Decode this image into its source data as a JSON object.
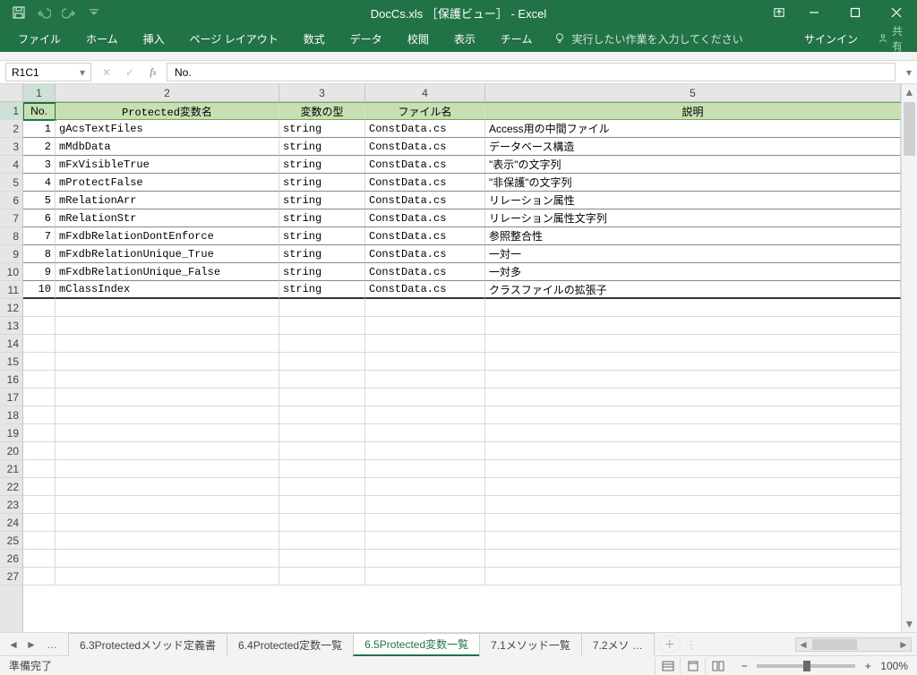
{
  "title": "DocCs.xls ［保護ビュー］ - Excel",
  "qat": {
    "save": "save",
    "undo": "undo",
    "redo": "redo"
  },
  "ribbon": {
    "tabs": [
      "ファイル",
      "ホーム",
      "挿入",
      "ページ レイアウト",
      "数式",
      "データ",
      "校閲",
      "表示",
      "チーム"
    ],
    "tellme": "実行したい作業を入力してください",
    "signin": "サインイン",
    "share": "共有"
  },
  "namebox": "R1C1",
  "formula": "No.",
  "columns": [
    "1",
    "2",
    "3",
    "4",
    "5"
  ],
  "headers": {
    "no": "No.",
    "name": "Protected変数名",
    "type": "変数の型",
    "file": "ファイル名",
    "desc": "説明"
  },
  "rows": [
    {
      "no": "1",
      "name": "gAcsTextFiles",
      "type": "string",
      "file": "ConstData.cs",
      "desc": "Access用の中間ファイル"
    },
    {
      "no": "2",
      "name": "mMdbData",
      "type": "string",
      "file": "ConstData.cs",
      "desc": "データベース構造"
    },
    {
      "no": "3",
      "name": "mFxVisibleTrue",
      "type": "string",
      "file": "ConstData.cs",
      "desc": "\"表示\"の文字列"
    },
    {
      "no": "4",
      "name": "mProtectFalse",
      "type": "string",
      "file": "ConstData.cs",
      "desc": "\"非保護\"の文字列"
    },
    {
      "no": "5",
      "name": "mRelationArr",
      "type": "string",
      "file": "ConstData.cs",
      "desc": "リレーション属性"
    },
    {
      "no": "6",
      "name": "mRelationStr",
      "type": "string",
      "file": "ConstData.cs",
      "desc": "リレーション属性文字列"
    },
    {
      "no": "7",
      "name": "mFxdbRelationDontEnforce",
      "type": "string",
      "file": "ConstData.cs",
      "desc": "参照整合性"
    },
    {
      "no": "8",
      "name": "mFxdbRelationUnique_True",
      "type": "string",
      "file": "ConstData.cs",
      "desc": "一対一"
    },
    {
      "no": "9",
      "name": "mFxdbRelationUnique_False",
      "type": "string",
      "file": "ConstData.cs",
      "desc": "一対多"
    },
    {
      "no": "10",
      "name": "mClassIndex",
      "type": "string",
      "file": "ConstData.cs",
      "desc": "クラスファイルの拡張子"
    }
  ],
  "row_count_visible": 27,
  "sheet_tabs": {
    "ellipsis": "…",
    "items": [
      {
        "label": "6.3Protectedメソッド定義書",
        "active": false
      },
      {
        "label": "6.4Protected定数一覧",
        "active": false
      },
      {
        "label": "6.5Protected変数一覧",
        "active": true
      },
      {
        "label": "7.1メソッド一覧",
        "active": false
      },
      {
        "label": "7.2メソ …",
        "active": false
      }
    ]
  },
  "status": {
    "ready": "準備完了",
    "zoom": "100%"
  }
}
